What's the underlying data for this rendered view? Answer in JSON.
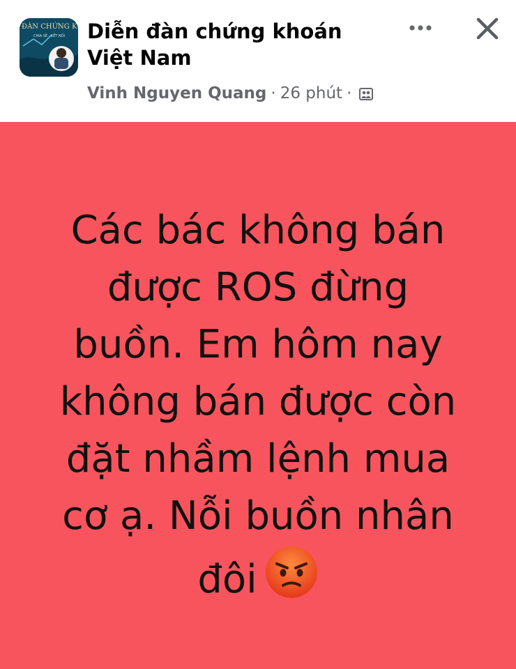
{
  "header": {
    "group_name": "Diễn đàn chứng khoán Việt Nam",
    "author": "Vinh Nguyen Quang",
    "separator": "·",
    "time_ago": "26 phút",
    "privacy_icon": "group-privacy-icon",
    "avatar_text_top": "ĐÀN CHỨNG K",
    "avatar_text_sub": "CHIA SẺ · KẾT NỐI"
  },
  "actions": {
    "more_icon": "more-horizontal-icon",
    "close_icon": "close-icon"
  },
  "post": {
    "text": "Các bác không bán\nđược ROS đừng\nbuồn. Em hôm nay\nkhông bán được còn\nđặt nhầm lệnh mua\ncơ ạ. Nỗi buồn nhân\nđôi",
    "emoji": "angry-face-emoji",
    "background_color": "#f8545d",
    "text_color": "#111111"
  }
}
